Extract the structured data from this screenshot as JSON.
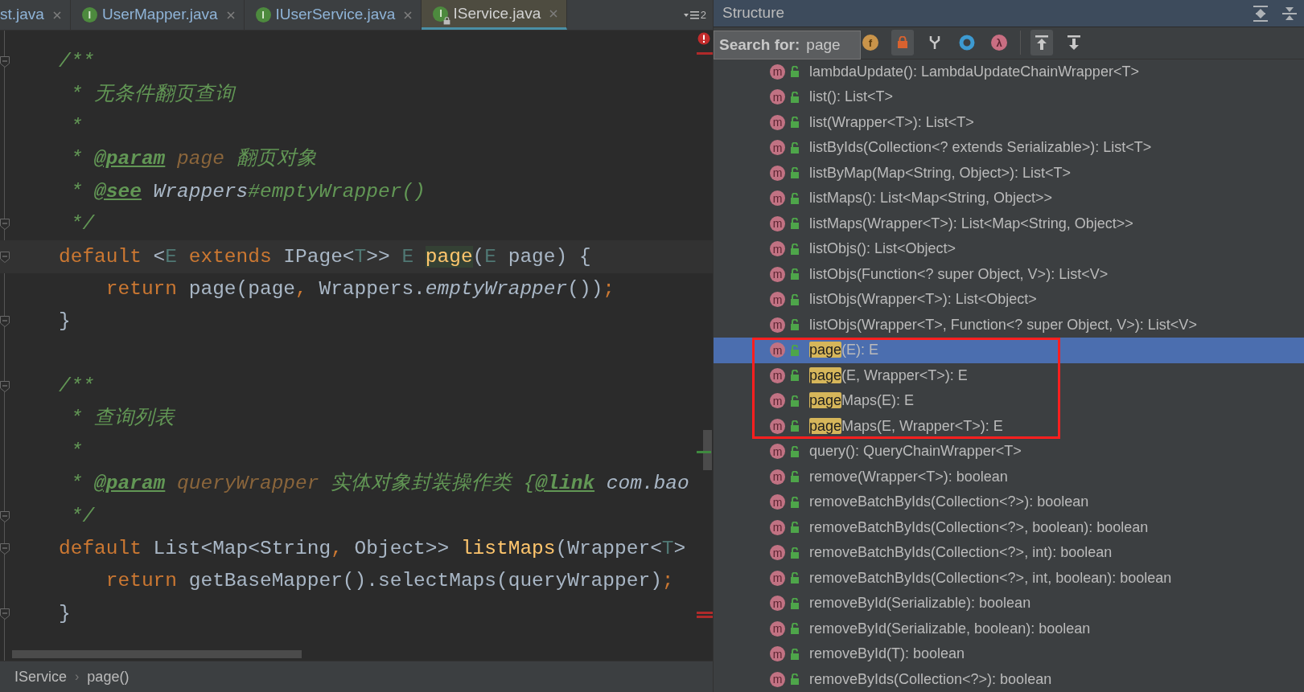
{
  "editor": {
    "tabs": [
      {
        "label": "st.java",
        "selected": false
      },
      {
        "badge": "I",
        "label": "UserMapper.java",
        "selected": false
      },
      {
        "badge": "I",
        "label": "IUserService.java",
        "selected": false
      },
      {
        "badge": "I",
        "label": "IService.java",
        "selected": true,
        "readonly": true
      }
    ],
    "tab_overflow_count": "2",
    "lines": [
      {
        "fold": true,
        "tokens": [
          {
            "kind": "comment",
            "text": "/**"
          }
        ]
      },
      {
        "tokens": [
          {
            "kind": "comment",
            "text": " * 无条件翻页查询"
          }
        ]
      },
      {
        "tokens": [
          {
            "kind": "comment",
            "text": " *"
          }
        ]
      },
      {
        "tokens": [
          {
            "kind": "comment",
            "text": " * "
          },
          {
            "kind": "tag",
            "text": "@param"
          },
          {
            "kind": "param",
            "text": " page"
          },
          {
            "kind": "comment",
            "text": " 翻页对象"
          }
        ]
      },
      {
        "tokens": [
          {
            "kind": "comment",
            "text": " * "
          },
          {
            "kind": "tag",
            "text": "@see"
          },
          {
            "kind": "docref",
            "text": " Wrappers"
          },
          {
            "kind": "comment",
            "text": "#emptyWrapper()"
          }
        ]
      },
      {
        "fold": true,
        "tokens": [
          {
            "kind": "comment",
            "text": " */"
          }
        ]
      },
      {
        "fold": true,
        "current": true,
        "tokens": [
          {
            "kind": "keyword",
            "text": "default"
          },
          {
            "kind": "plain",
            "text": " <"
          },
          {
            "kind": "typeparam",
            "text": "E"
          },
          {
            "kind": "keyword",
            "text": " extends"
          },
          {
            "kind": "plain",
            "text": " IPage<"
          },
          {
            "kind": "typeparam",
            "text": "T"
          },
          {
            "kind": "plain",
            "text": ">> "
          },
          {
            "kind": "typeparam",
            "text": "E "
          },
          {
            "kind": "method",
            "text": "page",
            "highlight": true
          },
          {
            "kind": "plain",
            "text": "("
          },
          {
            "kind": "typeparam",
            "text": "E"
          },
          {
            "kind": "plain",
            "text": " page) {"
          }
        ]
      },
      {
        "tokens": [
          {
            "kind": "keyword",
            "text": "    return"
          },
          {
            "kind": "plain",
            "text": " page(page"
          },
          {
            "kind": "punct",
            "text": ","
          },
          {
            "kind": "plain",
            "text": " Wrappers."
          },
          {
            "kind": "static",
            "text": "emptyWrapper"
          },
          {
            "kind": "plain",
            "text": "())"
          },
          {
            "kind": "punct",
            "text": ";"
          }
        ]
      },
      {
        "fold": true,
        "tokens": [
          {
            "kind": "plain",
            "text": "}"
          }
        ]
      },
      {
        "gap_before": true,
        "fold": true,
        "tokens": [
          {
            "kind": "comment",
            "text": "/**"
          }
        ]
      },
      {
        "tokens": [
          {
            "kind": "comment",
            "text": " * 查询列表"
          }
        ]
      },
      {
        "tokens": [
          {
            "kind": "comment",
            "text": " *"
          }
        ]
      },
      {
        "tokens": [
          {
            "kind": "comment",
            "text": " * "
          },
          {
            "kind": "tag",
            "text": "@param"
          },
          {
            "kind": "param",
            "text": " queryWrapper"
          },
          {
            "kind": "comment",
            "text": " 实体对象封装操作类 {"
          },
          {
            "kind": "tag",
            "text": "@link"
          },
          {
            "kind": "docref",
            "text": " com.bao"
          }
        ]
      },
      {
        "fold": true,
        "tokens": [
          {
            "kind": "comment",
            "text": " */"
          }
        ]
      },
      {
        "fold": true,
        "tokens": [
          {
            "kind": "keyword",
            "text": "default"
          },
          {
            "kind": "plain",
            "text": " List<Map<String"
          },
          {
            "kind": "punct",
            "text": ","
          },
          {
            "kind": "plain",
            "text": " Object>> "
          },
          {
            "kind": "method",
            "text": "listMaps"
          },
          {
            "kind": "plain",
            "text": "(Wrapper<"
          },
          {
            "kind": "typeparam",
            "text": "T"
          },
          {
            "kind": "plain",
            "text": ">"
          }
        ]
      },
      {
        "tokens": [
          {
            "kind": "keyword",
            "text": "    return"
          },
          {
            "kind": "plain",
            "text": " getBaseMapper().selectMaps(queryWrapper)"
          },
          {
            "kind": "punct",
            "text": ";"
          }
        ]
      },
      {
        "fold": true,
        "tokens": [
          {
            "kind": "plain",
            "text": "}"
          }
        ]
      }
    ],
    "breadcrumbs": [
      "IService",
      "page()"
    ],
    "breadcrumb_separator": "›"
  },
  "structure": {
    "title": "Structure",
    "search": {
      "label": "Search for:",
      "value": "page"
    },
    "toolbar": [
      {
        "kind": "field",
        "glyph": "f",
        "selected": false
      },
      {
        "kind": "lock",
        "selected": true
      },
      {
        "kind": "fork",
        "selected": false
      },
      {
        "kind": "circle",
        "selected": false
      },
      {
        "kind": "lambda",
        "glyph": "λ",
        "selected": false
      },
      {
        "kind": "separator"
      },
      {
        "kind": "up",
        "selected": true
      },
      {
        "kind": "down",
        "selected": false
      }
    ],
    "items": [
      {
        "badge": "m",
        "label": "lambdaUpdate(): LambdaUpdateChainWrapper<T>",
        "selected": false,
        "boxed": false
      },
      {
        "badge": "m",
        "label": "list(): List<T>",
        "selected": false,
        "boxed": false
      },
      {
        "badge": "m",
        "label": "list(Wrapper<T>): List<T>",
        "selected": false,
        "boxed": false
      },
      {
        "badge": "m",
        "label": "listByIds(Collection<? extends Serializable>): List<T>",
        "selected": false,
        "boxed": false
      },
      {
        "badge": "m",
        "label": "listByMap(Map<String, Object>): List<T>",
        "selected": false,
        "boxed": false
      },
      {
        "badge": "m",
        "label": "listMaps(): List<Map<String, Object>>",
        "selected": false,
        "boxed": false
      },
      {
        "badge": "m",
        "label": "listMaps(Wrapper<T>): List<Map<String, Object>>",
        "selected": false,
        "boxed": false
      },
      {
        "badge": "m",
        "label": "listObjs(): List<Object>",
        "selected": false,
        "boxed": false
      },
      {
        "badge": "m",
        "label": "listObjs(Function<? super Object, V>): List<V>",
        "selected": false,
        "boxed": false
      },
      {
        "badge": "m",
        "label": "listObjs(Wrapper<T>): List<Object>",
        "selected": false,
        "boxed": false
      },
      {
        "badge": "m",
        "label": "listObjs(Wrapper<T>, Function<? super Object, V>): List<V>",
        "selected": false,
        "boxed": false
      },
      {
        "badge": "m",
        "match": "page",
        "label": "(E): E",
        "selected": true,
        "boxed": true
      },
      {
        "badge": "m",
        "match": "page",
        "label": "(E, Wrapper<T>): E",
        "selected": false,
        "boxed": true
      },
      {
        "badge": "m",
        "match": "page",
        "label": "Maps(E): E",
        "selected": false,
        "boxed": true
      },
      {
        "badge": "m",
        "match": "page",
        "label": "Maps(E, Wrapper<T>): E",
        "selected": false,
        "boxed": true
      },
      {
        "badge": "m",
        "label": "query(): QueryChainWrapper<T>",
        "selected": false,
        "boxed": false
      },
      {
        "badge": "m",
        "label": "remove(Wrapper<T>): boolean",
        "selected": false,
        "boxed": false
      },
      {
        "badge": "m",
        "label": "removeBatchByIds(Collection<?>): boolean",
        "selected": false,
        "boxed": false
      },
      {
        "badge": "m",
        "label": "removeBatchByIds(Collection<?>, boolean): boolean",
        "selected": false,
        "boxed": false
      },
      {
        "badge": "m",
        "label": "removeBatchByIds(Collection<?>, int): boolean",
        "selected": false,
        "boxed": false
      },
      {
        "badge": "m",
        "label": "removeBatchByIds(Collection<?>, int, boolean): boolean",
        "selected": false,
        "boxed": false
      },
      {
        "badge": "m",
        "label": "removeById(Serializable): boolean",
        "selected": false,
        "boxed": false
      },
      {
        "badge": "m",
        "label": "removeById(Serializable, boolean): boolean",
        "selected": false,
        "boxed": false
      },
      {
        "badge": "m",
        "label": "removeById(T): boolean",
        "selected": false,
        "boxed": false
      },
      {
        "badge": "m",
        "label": "removeByIds(Collection<?>): boolean",
        "selected": false,
        "boxed": false
      }
    ]
  }
}
